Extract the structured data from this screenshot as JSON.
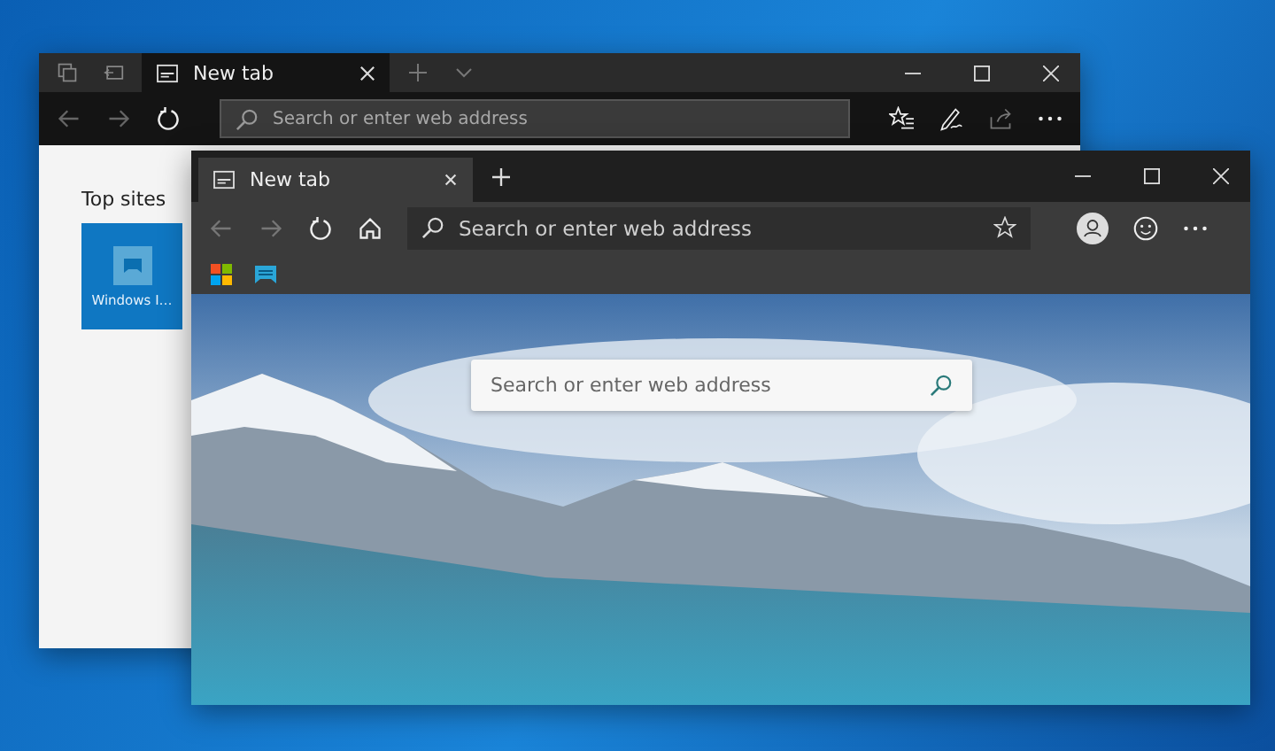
{
  "back_window": {
    "tabs": [
      {
        "label": "New tab",
        "selected": true
      }
    ],
    "address_bar": {
      "placeholder": "Search or enter web address"
    },
    "top_sites": {
      "heading": "Top sites",
      "tiles": [
        {
          "label": "Windows I…"
        }
      ]
    }
  },
  "front_window": {
    "tabs": [
      {
        "label": "New tab",
        "selected": true
      }
    ],
    "address_bar": {
      "placeholder": "Search or enter web address"
    },
    "page_search": {
      "placeholder": "Search or enter web address"
    }
  }
}
